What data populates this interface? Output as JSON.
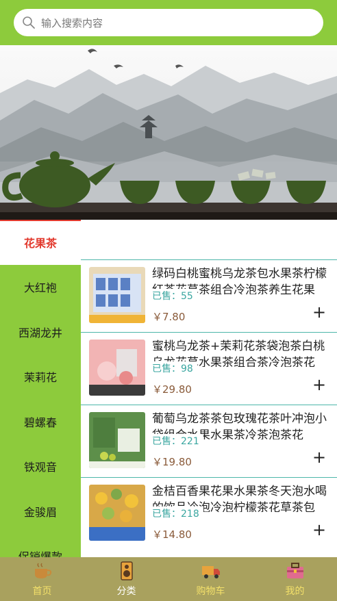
{
  "search": {
    "placeholder": "输入搜索内容"
  },
  "categories": [
    {
      "label": "花果茶",
      "active": true
    },
    {
      "label": "大红袍"
    },
    {
      "label": "西湖龙井"
    },
    {
      "label": "茉莉花"
    },
    {
      "label": "碧螺春"
    },
    {
      "label": "铁观音"
    },
    {
      "label": "金骏眉"
    },
    {
      "label": "促销爆款"
    }
  ],
  "products": [
    {
      "title": "绿码白桃蜜桃乌龙茶包水果茶柠檬红茶花草茶组合冷泡茶养生花果",
      "sold": "已售：55",
      "price": "￥7.80",
      "add": "+"
    },
    {
      "title": "蜜桃乌龙茶+茉莉花茶袋泡茶白桃乌龙花草水果茶组合茶冷泡茶花",
      "sold": "已售：98",
      "price": "￥29.80",
      "add": "+"
    },
    {
      "title": "葡萄乌龙茶茶包玫瑰花茶叶冲泡小袋组合水果水果茶冷茶泡茶花",
      "sold": "已售：221",
      "price": "￥19.80",
      "add": "+"
    },
    {
      "title": "金桔百香果花果水果茶冬天泡水喝的饮品冷泡冷泡柠檬茶花草茶包",
      "sold": "已售：218",
      "price": "￥14.80",
      "add": "+"
    }
  ],
  "tabs": [
    {
      "label": "首页",
      "icon": "coffee-cup-icon"
    },
    {
      "label": "分类",
      "icon": "speaker-icon",
      "active": true
    },
    {
      "label": "购物车",
      "icon": "truck-icon"
    },
    {
      "label": "我的",
      "icon": "briefcase-icon"
    }
  ],
  "colors": {
    "brand_green": "#8dcb3c",
    "active_red": "#e23a2e",
    "tabbar": "#a9a15e",
    "sold_teal": "#3aa6a0"
  }
}
